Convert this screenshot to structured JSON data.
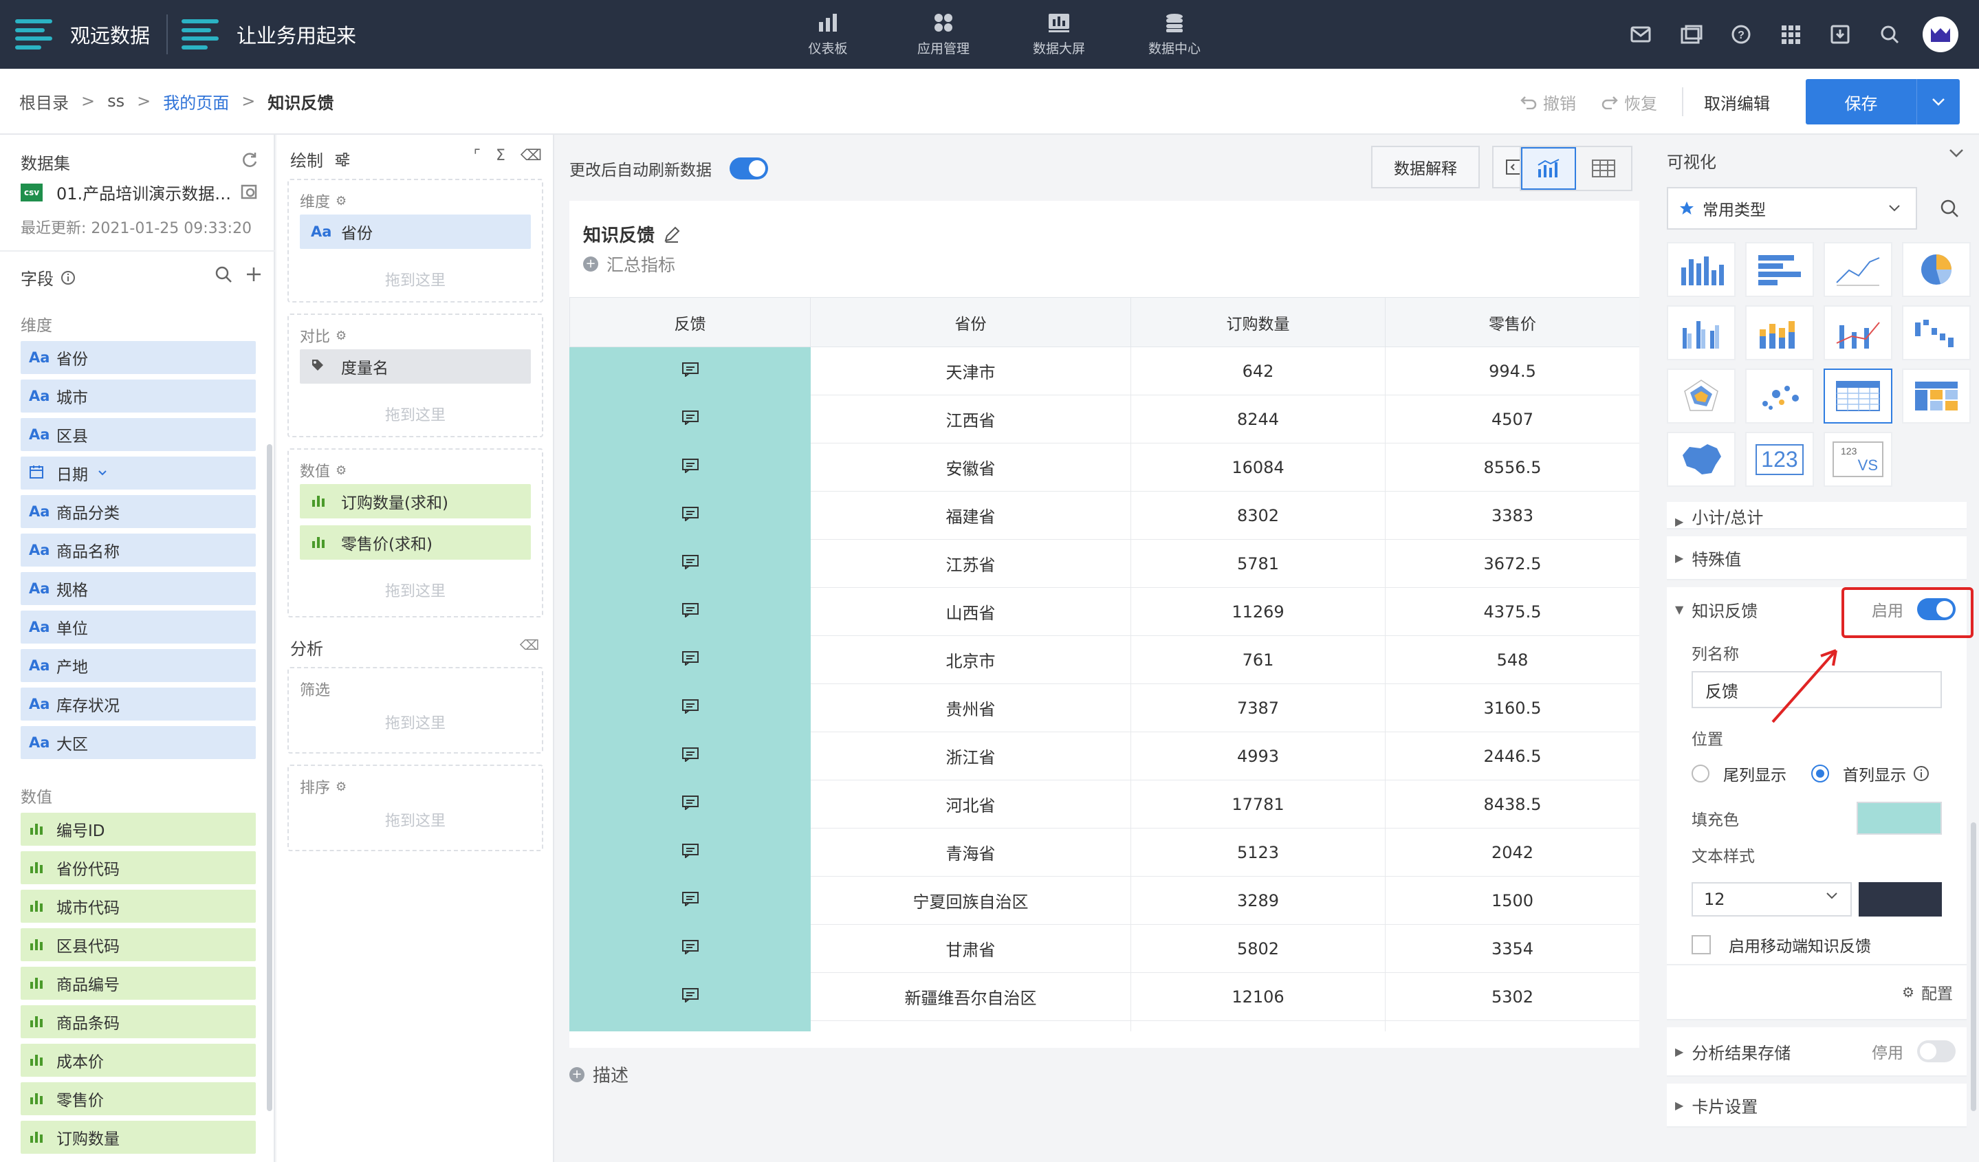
{
  "topbar": {
    "brand1": "观远数据",
    "brand2": "让业务用起来",
    "nav": [
      {
        "label": "仪表板",
        "icon": "bar-chart-icon"
      },
      {
        "label": "应用管理",
        "icon": "apps-icon"
      },
      {
        "label": "数据大屏",
        "icon": "screen-icon"
      },
      {
        "label": "数据中心",
        "icon": "database-icon"
      }
    ],
    "right_icons": [
      "mail-icon",
      "layout-icon",
      "help-icon",
      "grid-icon",
      "download-icon",
      "search-icon"
    ]
  },
  "subbar": {
    "breadcrumb": [
      "根目录",
      "ss",
      "我的页面",
      "知识反馈"
    ],
    "undo": "撤销",
    "redo": "恢复",
    "cancel": "取消编辑",
    "save": "保存"
  },
  "dataset": {
    "title": "数据集",
    "file_badge": "csv",
    "file_name": "01.产品培训演示数据…",
    "updated": "最近更新: 2021-01-25 09:33:20"
  },
  "fields": {
    "title": "字段",
    "dim_group": "维度",
    "dims": [
      {
        "icon": "Aa",
        "label": "省份"
      },
      {
        "icon": "Aa",
        "label": "城市"
      },
      {
        "icon": "Aa",
        "label": "区县"
      },
      {
        "icon": "日",
        "label": "日期"
      },
      {
        "icon": "Aa",
        "label": "商品分类"
      },
      {
        "icon": "Aa",
        "label": "商品名称"
      },
      {
        "icon": "Aa",
        "label": "规格"
      },
      {
        "icon": "Aa",
        "label": "单位"
      },
      {
        "icon": "Aa",
        "label": "产地"
      },
      {
        "icon": "Aa",
        "label": "库存状况"
      },
      {
        "icon": "Aa",
        "label": "大区"
      }
    ],
    "mea_group": "数值",
    "measures": [
      {
        "label": "编号ID"
      },
      {
        "label": "省份代码"
      },
      {
        "label": "城市代码"
      },
      {
        "label": "区县代码"
      },
      {
        "label": "商品编号"
      },
      {
        "label": "商品条码"
      },
      {
        "label": "成本价"
      },
      {
        "label": "零售价"
      },
      {
        "label": "订购数量"
      }
    ]
  },
  "draw": {
    "title": "绘制",
    "dim_zone": "维度",
    "dim_chip": "省份",
    "dim_icon": "Aa",
    "cmp_zone": "对比",
    "cmp_chip": "度量名",
    "val_zone": "数值",
    "val_chips": [
      "订购数量(求和)",
      "零售价(求和)"
    ],
    "drop": "拖到这里",
    "analysis": "分析",
    "filter": "筛选",
    "sort": "排序"
  },
  "center": {
    "auto_refresh": "更改后自动刷新数据",
    "explain_btn": "数据解释",
    "card_title": "知识反馈",
    "card_sub": "汇总指标",
    "describe": "描述",
    "columns": [
      "反馈",
      "省份",
      "订购数量",
      "零售价"
    ],
    "rows": [
      [
        "天津市",
        "642",
        "994.5"
      ],
      [
        "江西省",
        "8244",
        "4507"
      ],
      [
        "安徽省",
        "16084",
        "8556.5"
      ],
      [
        "福建省",
        "8302",
        "3383"
      ],
      [
        "江苏省",
        "5781",
        "3672.5"
      ],
      [
        "山西省",
        "11269",
        "4375.5"
      ],
      [
        "北京市",
        "761",
        "548"
      ],
      [
        "贵州省",
        "7387",
        "3160.5"
      ],
      [
        "浙江省",
        "4993",
        "2446.5"
      ],
      [
        "河北省",
        "17781",
        "8438.5"
      ],
      [
        "青海省",
        "5123",
        "2042"
      ],
      [
        "宁夏回族自治区",
        "3289",
        "1500"
      ],
      [
        "甘肃省",
        "5802",
        "3354"
      ],
      [
        "新疆维吾尔自治区",
        "12106",
        "5302"
      ]
    ],
    "fill_color": "#a3ddd9"
  },
  "vis": {
    "title": "可视化",
    "type_select": "常用类型",
    "number_tile": "123",
    "vs_tile": "VS",
    "subtotal": "小计/总计",
    "special": "特殊值",
    "kf_title": "知识反馈",
    "kf_enabled": "启用",
    "col_name_label": "列名称",
    "col_name_value": "反馈",
    "position_label": "位置",
    "pos_tail": "尾列显示",
    "pos_head": "首列显示",
    "fill_label": "填充色",
    "text_style_label": "文本样式",
    "font_size": "12",
    "mobile_label": "启用移动端知识反馈",
    "config": "配置",
    "store_label": "分析结果存储",
    "store_state": "停用",
    "card_settings": "卡片设置",
    "accent_color": "#2f7de1",
    "highlight_color": "#e02424"
  }
}
